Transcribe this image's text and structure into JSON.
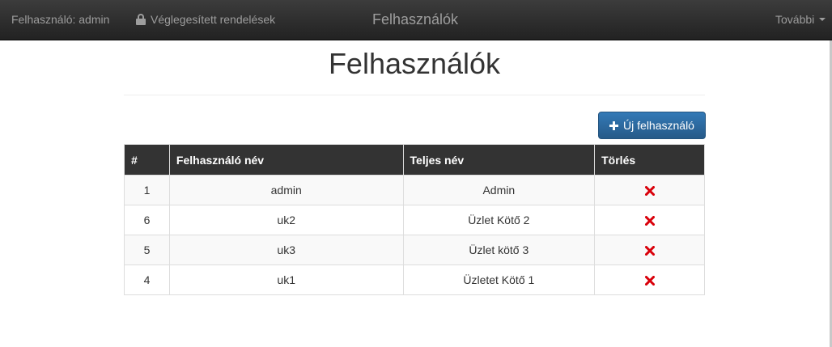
{
  "navbar": {
    "user_label": "Felhasználó: admin",
    "orders_label": "Véglegesített rendelések",
    "brand": "Felhasználók",
    "more_label": "További"
  },
  "page": {
    "title": "Felhasználók",
    "new_user_button": "Új felhasználó"
  },
  "table": {
    "headers": [
      "#",
      "Felhasználó név",
      "Teljes név",
      "Törlés"
    ],
    "rows": [
      {
        "id": "1",
        "username": "admin",
        "full_name": "Admin"
      },
      {
        "id": "6",
        "username": "uk2",
        "full_name": "Üzlet Kötő 2"
      },
      {
        "id": "5",
        "username": "uk3",
        "full_name": "Üzlet kötő 3"
      },
      {
        "id": "4",
        "username": "uk1",
        "full_name": "Üzletet Kötő 1"
      }
    ]
  },
  "colors": {
    "navbar": "#222222",
    "primary_button": "#337ab7",
    "delete_icon": "#d9000a"
  },
  "icons": {
    "lock": "lock-icon",
    "plus": "plus-icon",
    "delete": "remove-icon",
    "caret": "caret-down-icon"
  }
}
